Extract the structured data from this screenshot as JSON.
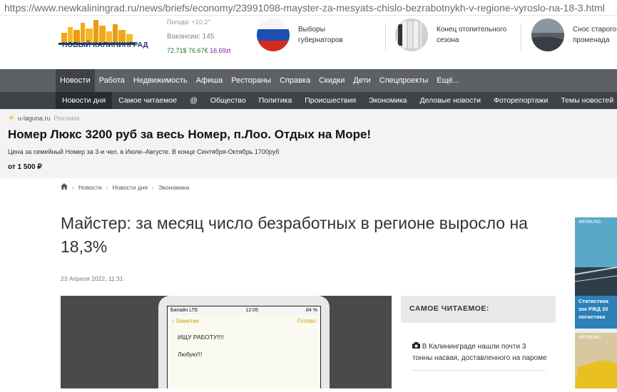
{
  "url": "https://www.newkaliningrad.ru/news/briefs/economy/23991098-mayster-za-mesyats-chislo-bezrabotnykh-v-regione-vyroslo-na-18-3.html",
  "header": {
    "logo_text": "НОВЫЙ КАЛИНИНГРАД",
    "weather": "Погода: +10.2°",
    "vacancies": "Вакансии: 145",
    "rate_usd": "72.71$",
    "rate_eur": "76.67€",
    "rate_pln": "16.69zł",
    "promos": [
      {
        "line1": "Выборы",
        "line2": "губернаторов"
      },
      {
        "line1": "Конец отопительного",
        "line2": "сезона"
      },
      {
        "line1": "Снос старого",
        "line2": "променада"
      }
    ]
  },
  "nav_main": [
    "Новости",
    "Работа",
    "Недвижимость",
    "Афиша",
    "Рестораны",
    "Справка",
    "Скидки",
    "Дети",
    "Спецпроекты",
    "Ещё..."
  ],
  "nav_sub": [
    "Новости дня",
    "Самое читаемое",
    "@",
    "Общество",
    "Политика",
    "Происшествия",
    "Экономика",
    "Деловые новости",
    "Фоторепортажи",
    "Темы новостей"
  ],
  "ad": {
    "source": "u-laguna.ru",
    "tag": "Реклама",
    "title": "Номер Люкс 3200 руб за весь Номер, п.Лоо. Отдых на Море!",
    "description": "Цена за семейный Номер за 3-и чел. в Июле–Августе. В конце Сентября-Октябрь 1700руб",
    "price": "от 1 500 ₽"
  },
  "breadcrumbs": [
    "Новости",
    "Новости дня",
    "Экономика"
  ],
  "article": {
    "title": "Майстер: за месяц число безработных в регионе выросло на 18,3%",
    "date": "23 Апреля 2022, 11:31"
  },
  "photo": {
    "carrier": "Билайн LTE",
    "time": "12:05",
    "battery": "84 %",
    "back_label": "Заметки",
    "done_label": "Готово",
    "note_line1": "ИЩУ РАБОТУ!!!!",
    "note_line2": "Любую!!!"
  },
  "most_read": {
    "heading": "САМОЕ ЧИТАЕМОЕ:",
    "items": [
      "В Калининграде нашли почти 3 тонны насвая, доставленного на пароме"
    ]
  },
  "side_ad": {
    "brand": "WERBUNG",
    "caption": "Статистика зок РЖД 20 логистика",
    "brand2": "WERBUNG"
  }
}
